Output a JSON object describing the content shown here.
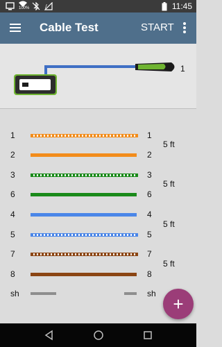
{
  "status_bar": {
    "time": "11:45",
    "battery_percent_label": "100%",
    "icons": [
      "screen-cast-icon",
      "wifi-icon",
      "bluetooth-off-icon",
      "signal-icon",
      "battery-icon"
    ]
  },
  "app_bar": {
    "title": "Cable Test",
    "start_label": "START",
    "menu_icon": "hamburger-icon",
    "overflow_icon": "more-vert-icon",
    "color": "#4f6f8b"
  },
  "diagram": {
    "remote_label": "1",
    "device_color": "#6fb431",
    "cable_color": "#3f6fc4"
  },
  "wires": [
    {
      "left": "1",
      "right": "1",
      "color": "#f28c1b",
      "style": "striped"
    },
    {
      "left": "2",
      "right": "2",
      "color": "#f28c1b",
      "style": "solid"
    },
    {
      "left": "3",
      "right": "3",
      "color": "#1a8a1a",
      "style": "striped"
    },
    {
      "left": "6",
      "right": "6",
      "color": "#1a8a1a",
      "style": "solid"
    },
    {
      "left": "4",
      "right": "4",
      "color": "#4a86e8",
      "style": "solid"
    },
    {
      "left": "5",
      "right": "5",
      "color": "#4a86e8",
      "style": "striped"
    },
    {
      "left": "7",
      "right": "7",
      "color": "#8b4513",
      "style": "striped"
    },
    {
      "left": "8",
      "right": "8",
      "color": "#8b4513",
      "style": "solid"
    },
    {
      "left": "sh",
      "right": "sh",
      "color": "#8e8e8e",
      "style": "shield"
    }
  ],
  "pair_lengths": [
    "5 ft",
    "5 ft",
    "5 ft",
    "5 ft"
  ],
  "fab": {
    "label": "+",
    "color": "#9b3d78"
  },
  "nav": {
    "back_icon": "back-icon",
    "home_icon": "home-icon",
    "recents_icon": "recents-icon"
  }
}
